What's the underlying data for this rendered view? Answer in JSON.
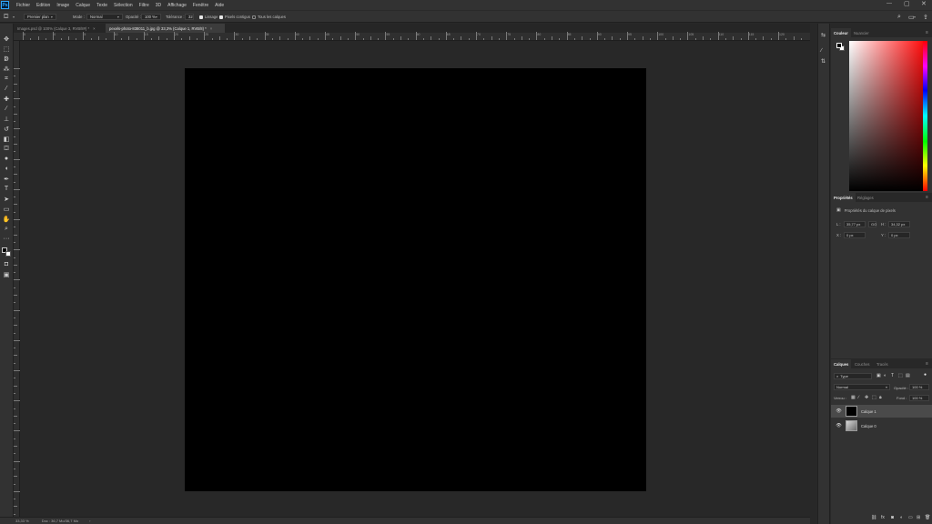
{
  "app": {
    "logo": "Ps"
  },
  "menu": [
    "Fichier",
    "Edition",
    "Image",
    "Calque",
    "Texte",
    "Sélection",
    "Filtre",
    "3D",
    "Affichage",
    "Fenêtre",
    "Aide"
  ],
  "options": {
    "tool_preset": "Premier plan",
    "mode_label": "Mode :",
    "mode_value": "Normal",
    "opacity_label": "Opacité :",
    "opacity_value": "100 %",
    "tolerance_label": "Tolérance :",
    "tolerance_value": "32",
    "smoothing_label": "Lissage",
    "contiguous_label": "Pixels contigus",
    "all_layers_label": "Tous les calques"
  },
  "tabs": [
    {
      "label": "Images.psd @ 100% (Calque 3, RVB/8#) *",
      "close": "×"
    },
    {
      "label": "pexels-photo-838011_b.jpg @ 33,3% (Calque 1, RVB/8) *",
      "close": "×"
    }
  ],
  "ruler_labels": [
    "5",
    "0",
    "5",
    "10",
    "15",
    "20",
    "25",
    "30",
    "35",
    "40",
    "45",
    "50",
    "55",
    "60",
    "65",
    "70",
    "75",
    "80",
    "85",
    "90",
    "95",
    "100",
    "105",
    "110",
    "115",
    "120",
    "125",
    "130"
  ],
  "status": {
    "zoom": "33,33 %",
    "doc": "Doc : 36,7 Mo/36,7 Mo"
  },
  "color_panel": {
    "tabs": [
      "Couleur",
      "Nuancier"
    ]
  },
  "properties_panel": {
    "tabs": [
      "Propriétés",
      "Réglages"
    ],
    "title": "Propriétés du calque de pixels",
    "w_label": "L :",
    "w_value": "35,77 px",
    "link_label": "GO",
    "h_label": "H :",
    "h_value": "34,32 px",
    "x_label": "X :",
    "x_value": "0 px",
    "y_label": "Y :",
    "y_value": "0 px"
  },
  "layers_panel": {
    "tabs": [
      "Calques",
      "Couches",
      "Tracés"
    ],
    "filter": "Type",
    "blend": "Normal",
    "opacity_label": "Opacité :",
    "opacity_value": "100 %",
    "lock_label": "Verrou :",
    "fill_label": "Fond :",
    "fill_value": "100 %",
    "layers": [
      {
        "name": "Calque 1",
        "selected": true
      },
      {
        "name": "Calque 0",
        "selected": false
      }
    ]
  },
  "colors": {
    "accent": "#31a8ff",
    "panel": "#323232",
    "canvas": "#282828",
    "document": "#000000"
  }
}
